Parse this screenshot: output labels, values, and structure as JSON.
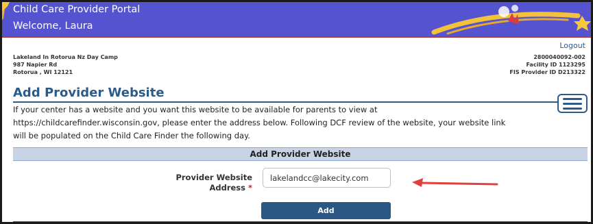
{
  "header": {
    "portal_title": "Child Care Provider Portal",
    "welcome": "Welcome, Laura"
  },
  "provider": {
    "name": "Lakeland In Rotorua Nz Day Camp",
    "street": "987 Napier Rd",
    "city_state_zip": "Rotorua , WI 12121",
    "logout_label": "Logout",
    "license_number": "2800040092-002",
    "facility_id": "Facility ID 1123295",
    "fis_provider_id": "FIS Provider ID D213322"
  },
  "page": {
    "title": "Add Provider Website",
    "description_lines": [
      "If your center has a website and you want this website to be available for parents to view at",
      "https://childcarefinder.wisconsin.gov, please enter the address below. Following DCF review of the website, your website link",
      "will be populated on the Child Care Finder the following day."
    ]
  },
  "form": {
    "section_header": "Add Provider Website",
    "field_label_line1": "Provider Website",
    "field_label_line2": "Address",
    "required_marker": "*",
    "website_value": "lakelandcc@lakecity.com",
    "add_button_label": "Add"
  },
  "colors": {
    "banner": "#5553cf",
    "accent_blue": "#2b5b8a",
    "section_bar": "#c8d4e6",
    "arrow_red": "#e0413c"
  },
  "icons": {
    "menu": "hamburger-menu-icon",
    "annotation": "red-arrow-icon"
  }
}
